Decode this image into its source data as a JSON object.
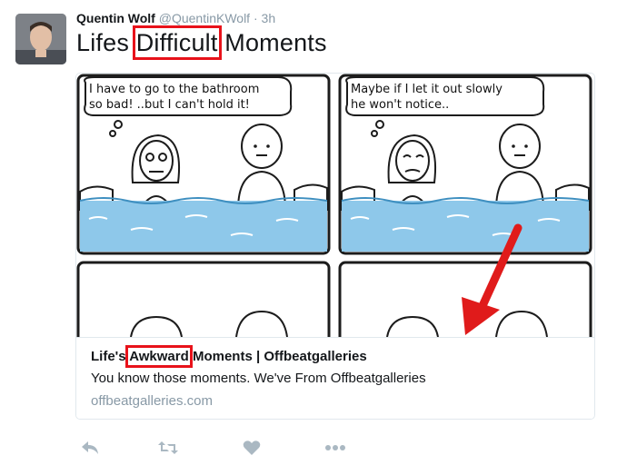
{
  "tweet": {
    "author_name": "Quentin Wolf",
    "author_handle": "@QuentinKWolf",
    "separator": "·",
    "time": "3h",
    "text_parts": [
      "Lifes ",
      "Difficult",
      " Moments"
    ]
  },
  "comic": {
    "panel1_speech": [
      "I have to go to the bathroom",
      "so bad! ..but I can't hold it!"
    ],
    "panel2_speech": [
      "Maybe if I let it out slowly",
      "he won't notice.."
    ]
  },
  "card": {
    "title_parts": [
      "Life's ",
      "Awkward",
      " Moments | Offbeatgalleries"
    ],
    "description": "You know those moments. We've From Offbeatgalleries",
    "domain": "offbeatgalleries.com"
  },
  "actions": {
    "icons": [
      "reply-icon",
      "retweet-icon",
      "like-icon",
      "more-icon"
    ]
  },
  "colors": {
    "highlight": "#e8121a",
    "water": "#8ec8ea",
    "arrow": "#e01b1b",
    "muted": "#8899a6",
    "icon": "#aab8c2"
  }
}
